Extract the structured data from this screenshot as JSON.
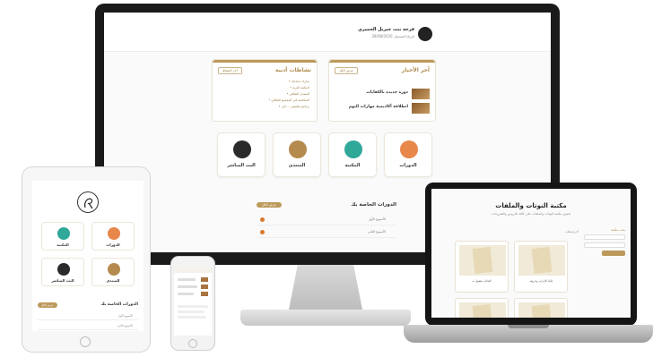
{
  "colors": {
    "gold": "#bc9a5c",
    "gold_text": "#b08b4c",
    "teal": "#2fa89a",
    "brown": "#b58a4e",
    "dark": "#222222",
    "orange": "#d9782d"
  },
  "desktop": {
    "user": {
      "name": "فرحة بنت جبريل الحميري",
      "subtitle": "تاريخ التسجيل 28/08/2020",
      "avatar_icon": "user-avatar-icon"
    },
    "news": {
      "title": "آخر الأخبار",
      "button": "عرض الكل",
      "items": [
        "دورة جديدة بالكفايات",
        "انطلاقة أكاديمية مهارات اليوم"
      ]
    },
    "literary": {
      "title": "نشاطات أدبية",
      "button": "آخر النشاط",
      "items": [
        "• شارك نماذجك",
        "• المكتبة الثرية",
        "• المنتدى الثقافي",
        "• المنافسة في المجتمع الثقافي",
        "• برنامج تطبيقي ... إلى"
      ]
    },
    "tiles": [
      {
        "label": "الدورات",
        "icon": "courses-icon",
        "color": "#e8874a"
      },
      {
        "label": "المكتبة",
        "icon": "library-icon",
        "color": "#2fa89a"
      },
      {
        "label": "المنتدى",
        "icon": "forum-icon",
        "color": "#b58a4e"
      },
      {
        "label": "البث المباشر",
        "icon": "microphone-icon",
        "color": "#2b2b2b"
      }
    ],
    "courses": {
      "title": "الدورات الخاصة بك",
      "button": "عرض الكل",
      "items": [
        "الأسبوع الأول",
        "الأسبوع الثاني"
      ]
    }
  },
  "laptop": {
    "title": "مكتبة النوتات والملفات",
    "subtitle": "تحتوي مكتبة النوتات والملفات على كافة الدروس والشروحات",
    "sidebar": {
      "heading": "بحث مكتبة",
      "search_button": "بحث"
    },
    "filter_label": "آخر إضافات",
    "docs": [
      {
        "caption": "الفاعل  مفعول به"
      },
      {
        "caption": "إلياء الإعراب وحروفه"
      },
      {
        "caption": ""
      },
      {
        "caption": ""
      }
    ]
  },
  "tablet": {
    "logo_icon": "calligraphy-logo-icon",
    "tiles": [
      {
        "label": "الدورات",
        "icon": "courses-icon",
        "color": "#e8874a"
      },
      {
        "label": "المكتبة",
        "icon": "library-icon",
        "color": "#2fa89a"
      },
      {
        "label": "المنتدى",
        "icon": "forum-icon",
        "color": "#b58a4e"
      },
      {
        "label": "البث المباشر",
        "icon": "microphone-icon",
        "color": "#2b2b2b"
      }
    ],
    "courses": {
      "title": "الدورات الخاصة بك",
      "button": "عرض الكل",
      "items": [
        "الأسبوع الأول",
        "الأسبوع الثاني"
      ]
    }
  },
  "phone": {
    "screen": "news-list"
  }
}
